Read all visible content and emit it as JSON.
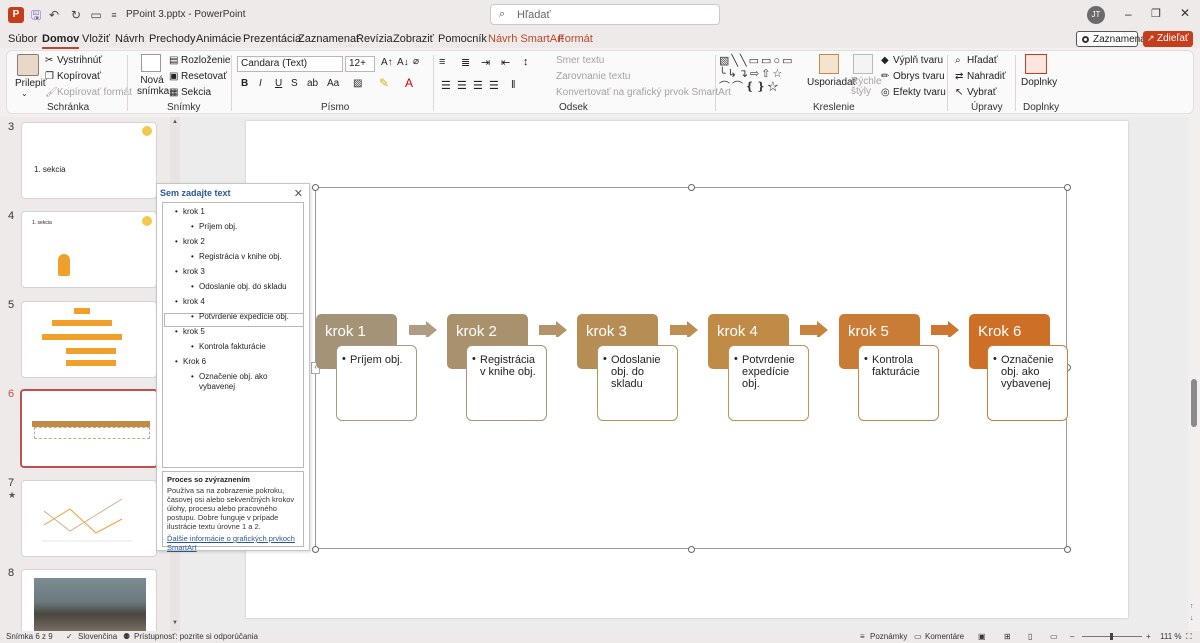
{
  "window": {
    "title": "PPoint 3.pptx  -  PowerPoint",
    "search_placeholder": "Hľadať",
    "user_initials": "JT"
  },
  "menu": {
    "items": [
      "Súbor",
      "Domov",
      "Vložiť",
      "Návrh",
      "Prechody",
      "Animácie",
      "Prezentácia",
      "Zaznamenať",
      "Revízia",
      "Zobraziť",
      "Pomocník",
      "Návrh SmartArt",
      "Formát"
    ],
    "active": "Domov",
    "record_button": "Zaznamenať",
    "share_button": "Zdieľať"
  },
  "ribbon": {
    "clipboard": {
      "paste": "Prilepiť",
      "cut": "Vystrihnúť",
      "copy": "Kopírovať",
      "format_painter": "Kopírovať formát",
      "label": "Schránka"
    },
    "slides": {
      "new_slide": "Nová snímka",
      "layout": "Rozloženie",
      "reset": "Resetovať",
      "section": "Sekcia",
      "label": "Snímky"
    },
    "font": {
      "name": "Candara (Text)",
      "size": "12+",
      "label": "Písmo",
      "bold": "B",
      "italic": "I",
      "underline": "U",
      "strike": "S"
    },
    "paragraph": {
      "text_direction": "Smer textu",
      "align_text": "Zarovnanie textu",
      "convert": "Konvertovať na grafický prvok SmartArt",
      "label": "Odsek"
    },
    "drawing": {
      "arrange": "Usporiadať",
      "quick_styles": "Rýchle štýly",
      "fill": "Výplň tvaru",
      "outline": "Obrys tvaru",
      "effects": "Efekty tvaru",
      "label": "Kreslenie"
    },
    "editing": {
      "find": "Hľadať",
      "replace": "Nahradiť",
      "select": "Vybrať",
      "label": "Úpravy"
    },
    "addins": {
      "button": "Doplnky",
      "label": "Doplnky"
    }
  },
  "thumbnails": [
    {
      "num": "3",
      "title": "1. sekcia"
    },
    {
      "num": "4",
      "title": "1. sekcia"
    },
    {
      "num": "5",
      "title": ""
    },
    {
      "num": "6",
      "title": ""
    },
    {
      "num": "7",
      "title": ""
    },
    {
      "num": "8",
      "title": ""
    }
  ],
  "text_pane": {
    "title": "Sem zadajte text",
    "items": [
      {
        "level": 1,
        "text": "krok 1"
      },
      {
        "level": 2,
        "text": "Príjem obj."
      },
      {
        "level": 1,
        "text": "krok 2"
      },
      {
        "level": 2,
        "text": "Registrácia v knihe obj."
      },
      {
        "level": 1,
        "text": "krok 3"
      },
      {
        "level": 2,
        "text": "Odoslanie obj. do skladu"
      },
      {
        "level": 1,
        "text": "krok 4"
      },
      {
        "level": 2,
        "text": "Potvrdenie expedície obj."
      },
      {
        "level": 1,
        "text": "krok 5"
      },
      {
        "level": 2,
        "text": "Kontrola fakturácie"
      },
      {
        "level": 1,
        "text": "Krok 6"
      },
      {
        "level": 2,
        "text": "Označenie obj. ako vybavenej"
      }
    ],
    "desc_title": "Proces so zvýraznením",
    "desc_text": "Používa sa na zobrazenie pokroku, časovej osi alebo sekvenčných krokov úlohy, procesu alebo pracovného postupu. Dobre funguje v prípade ilustrácie textu úrovne 1 a 2.",
    "desc_link": "Ďalšie informácie o grafických prvkoch SmartArt"
  },
  "smartart": {
    "steps": [
      {
        "title": "krok 1",
        "body": [
          "Príjem obj."
        ],
        "color": "#a59378",
        "border": "#a89a85"
      },
      {
        "title": "krok 2",
        "body": [
          "Registrácia",
          "v knihe obj."
        ],
        "color": "#a9916c",
        "border": "#a8967a"
      },
      {
        "title": "krok 3",
        "body": [
          "Odoslanie",
          "obj. do",
          "skladu"
        ],
        "color": "#b58d55",
        "border": "#b59567"
      },
      {
        "title": "krok 4",
        "body": [
          "Potvrdenie",
          "expedície",
          "obj."
        ],
        "color": "#c08a47",
        "border": "#c09158"
      },
      {
        "title": "krok 5",
        "body": [
          "Kontrola",
          "fakturácie"
        ],
        "color": "#c87c35",
        "border": "#c48a4c"
      },
      {
        "title": "Krok 6",
        "body": [
          "Označenie",
          "obj. ako",
          "vybavenej"
        ],
        "color": "#cd6f26",
        "border": "#c9803c"
      }
    ],
    "arrow_colors": [
      "#b09c82",
      "#b49368",
      "#bf8f52",
      "#c6843f",
      "#cc7630"
    ]
  },
  "status": {
    "slide": "Snímka 6 z 9",
    "language": "Slovenčina",
    "accessibility": "Prístupnosť: pozrite si odporúčania",
    "notes": "Poznámky",
    "comments": "Komentáre",
    "zoom": "111 %"
  }
}
